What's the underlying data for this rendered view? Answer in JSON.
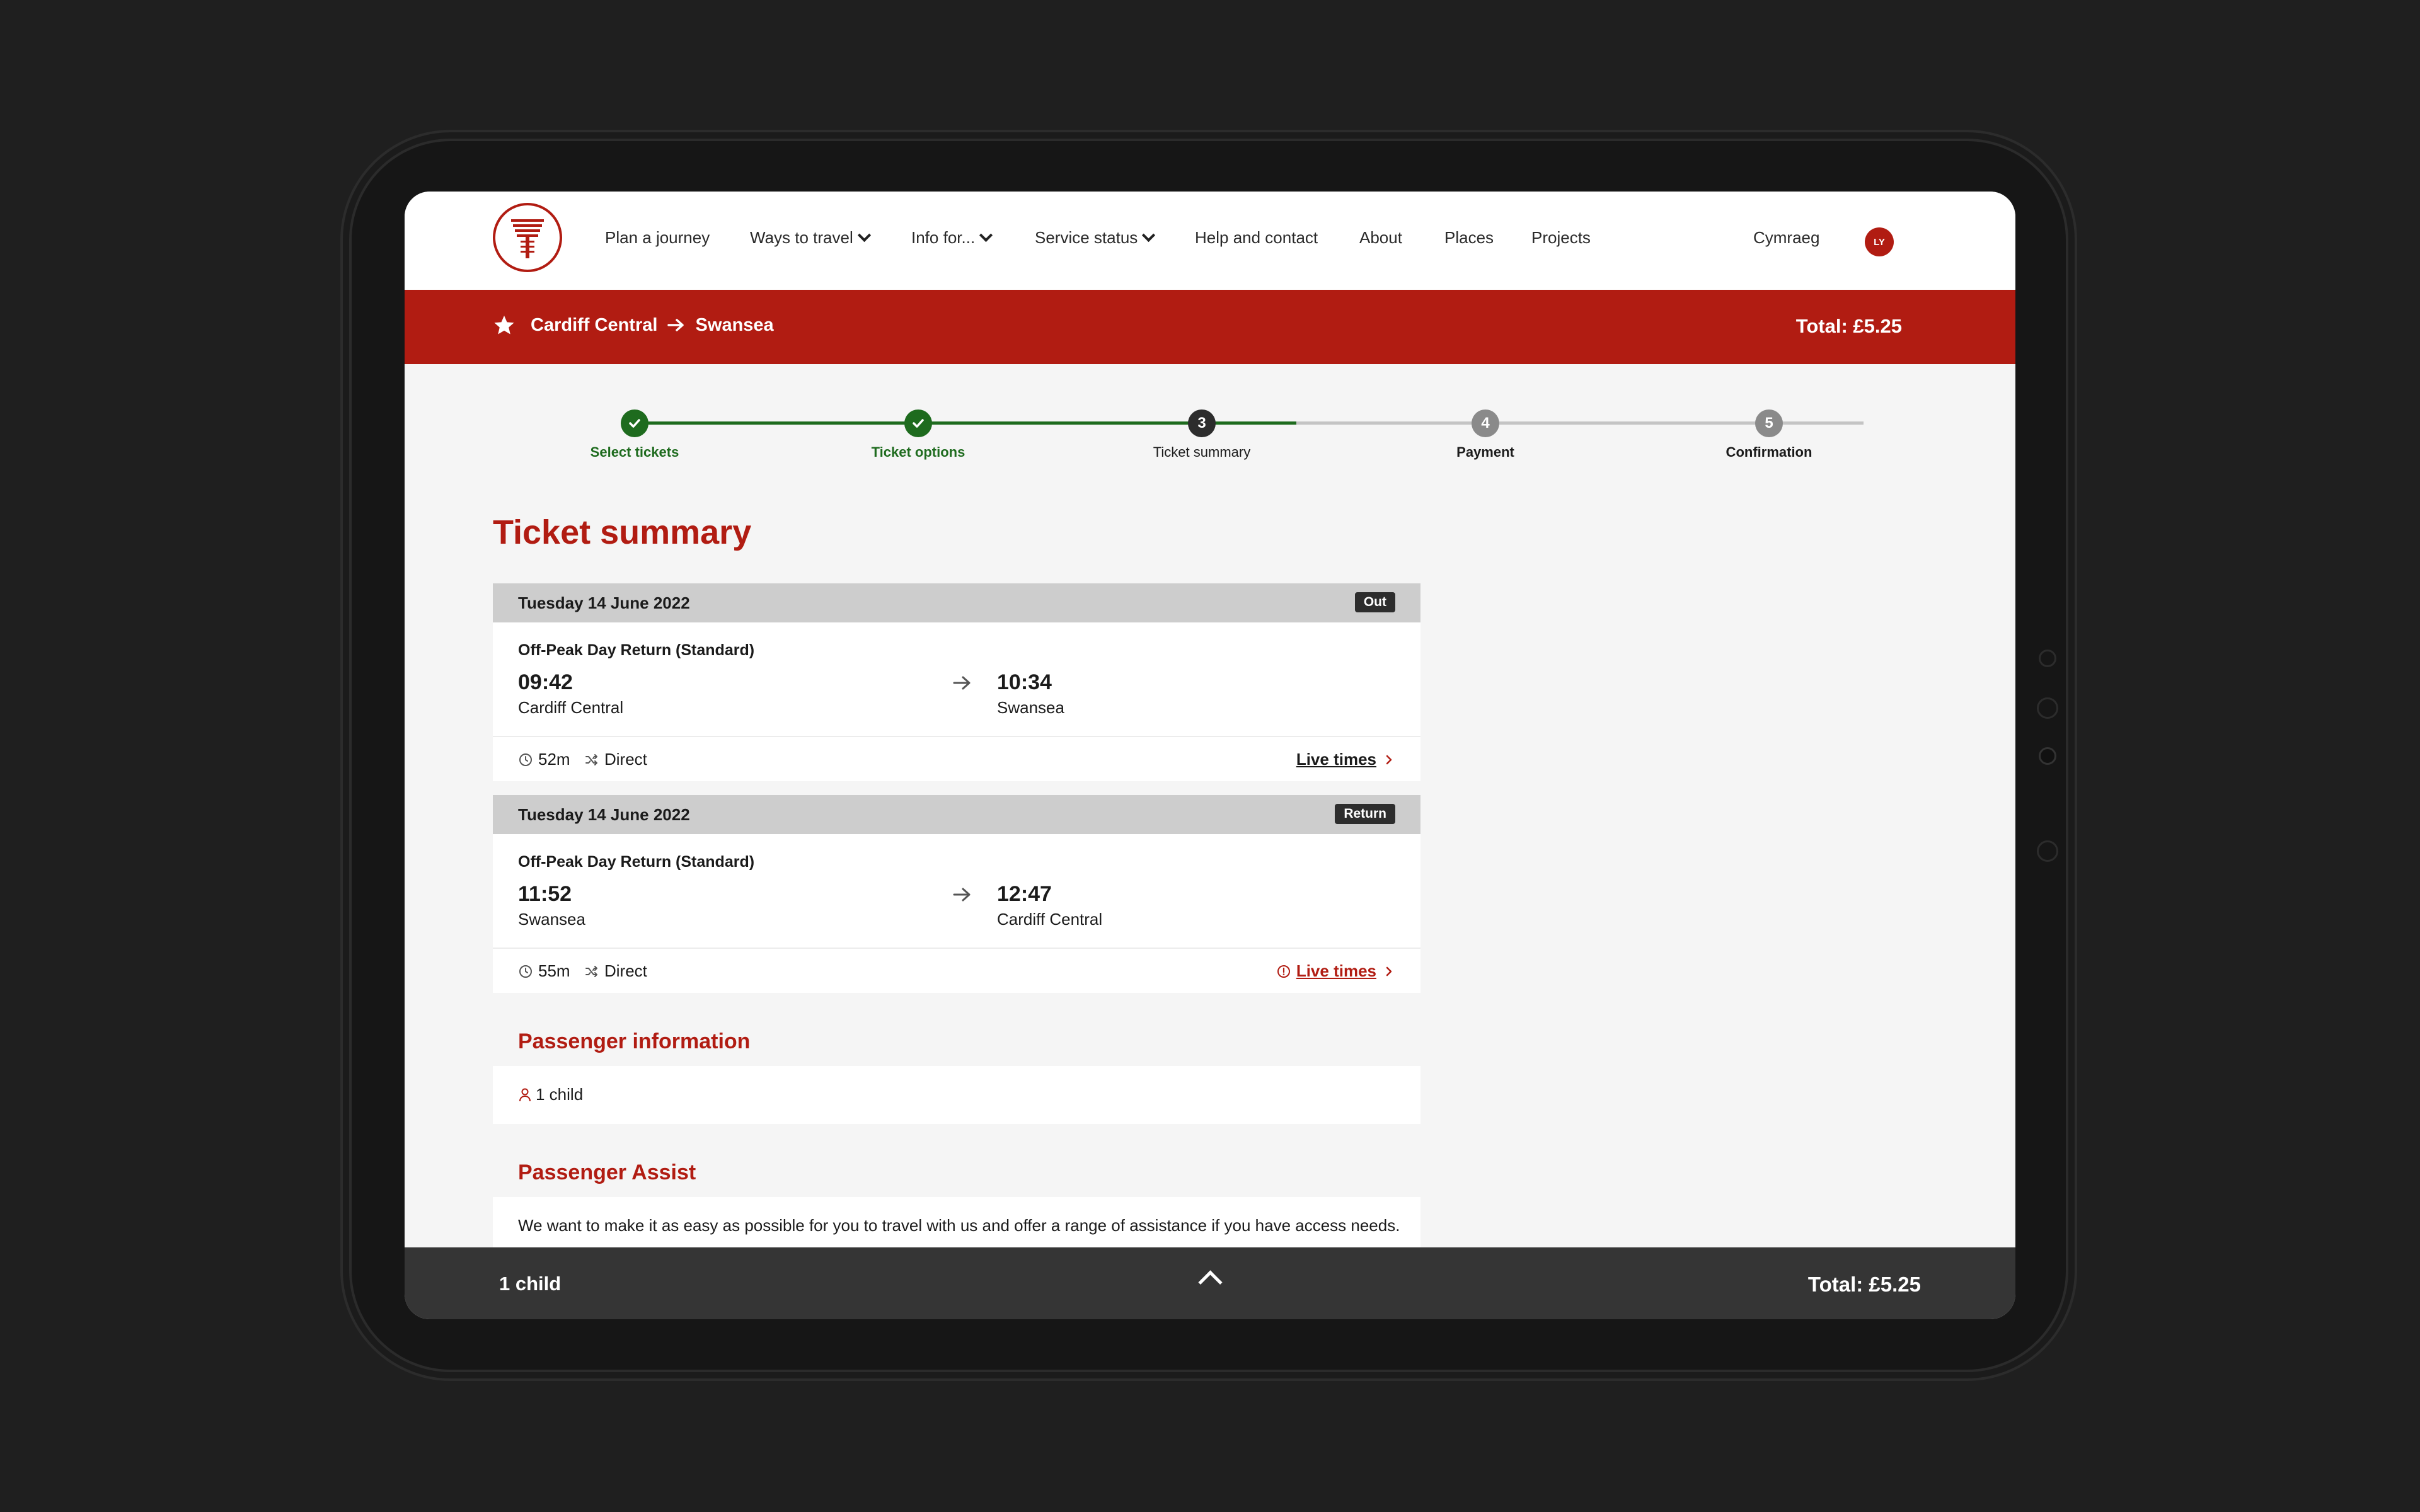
{
  "brand": {
    "accent": "#b11c12",
    "success": "#1e6b1e",
    "dark": "#2d2d2d"
  },
  "nav": {
    "items": [
      {
        "label": "Plan a journey",
        "dropdown": false
      },
      {
        "label": "Ways to travel",
        "dropdown": true
      },
      {
        "label": "Info for...",
        "dropdown": true
      },
      {
        "label": "Service status",
        "dropdown": true
      },
      {
        "label": "Help and contact",
        "dropdown": false
      },
      {
        "label": "About",
        "dropdown": false
      },
      {
        "label": "Places",
        "dropdown": false
      },
      {
        "label": "Projects",
        "dropdown": false
      }
    ],
    "language": "Cymraeg",
    "avatar_initials": "LY"
  },
  "journey": {
    "origin": "Cardiff Central",
    "destination": "Swansea",
    "total": "Total: £5.25"
  },
  "steps": [
    {
      "number": "1",
      "label": "Select tickets",
      "status": "complete"
    },
    {
      "number": "2",
      "label": "Ticket options",
      "status": "complete"
    },
    {
      "number": "3",
      "label": "Ticket summary",
      "status": "current"
    },
    {
      "number": "4",
      "label": "Payment",
      "status": "upcoming"
    },
    {
      "number": "5",
      "label": "Confirmation",
      "status": "upcoming"
    }
  ],
  "page_title": "Ticket summary",
  "tickets": [
    {
      "date": "Tuesday 14 June 2022",
      "badge": "Out",
      "ticket_type": "Off-Peak Day Return (Standard)",
      "depart_time": "09:42",
      "depart_station": "Cardiff Central",
      "arrive_time": "10:34",
      "arrive_station": "Swansea",
      "duration": "52m",
      "changes": "Direct",
      "live_label": "Live times",
      "live_alert": false
    },
    {
      "date": "Tuesday 14 June 2022",
      "badge": "Return",
      "ticket_type": "Off-Peak Day Return (Standard)",
      "depart_time": "11:52",
      "depart_station": "Swansea",
      "arrive_time": "12:47",
      "arrive_station": "Cardiff Central",
      "duration": "55m",
      "changes": "Direct",
      "live_label": "Live times",
      "live_alert": true
    }
  ],
  "passenger_info": {
    "title": "Passenger information",
    "passengers": "1 child"
  },
  "passenger_assist": {
    "title": "Passenger Assist",
    "text": "We want to make it as easy as possible for you to travel with us and offer a range of assistance if you have access needs."
  },
  "bottom_bar": {
    "passengers": "1 child",
    "total": "Total: £5.25"
  }
}
